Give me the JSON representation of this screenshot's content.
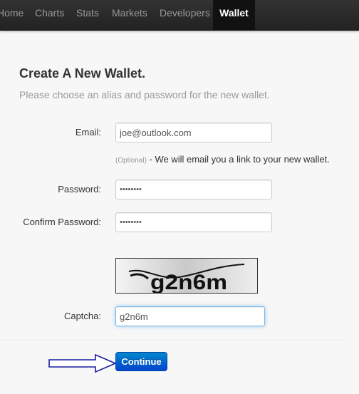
{
  "navbar": {
    "items": [
      {
        "label": "Home"
      },
      {
        "label": "Charts"
      },
      {
        "label": "Stats"
      },
      {
        "label": "Markets"
      },
      {
        "label": "Developers"
      },
      {
        "label": "Wallet",
        "active": true
      }
    ]
  },
  "page": {
    "title": "Create A New Wallet.",
    "subtitle": "Please choose an alias and password for the new wallet."
  },
  "form": {
    "email_label": "Email:",
    "email_value": "joe@outlook.com",
    "email_help_optional": "(Optional)",
    "email_help_text": " - We will email you a link to your new wallet.",
    "password_label": "Password:",
    "password_value": "••••••••",
    "confirm_label": "Confirm Password:",
    "confirm_value": "••••••••",
    "captcha_image_text": "g2n6m",
    "captcha_label": "Captcha:",
    "captcha_value": "g2n6m",
    "continue_label": "Continue"
  },
  "colors": {
    "navbar_bg": "#222222",
    "active_tab_bg": "#111111",
    "button_blue": "#0055cc",
    "arrow_color": "#1a1aa6"
  }
}
